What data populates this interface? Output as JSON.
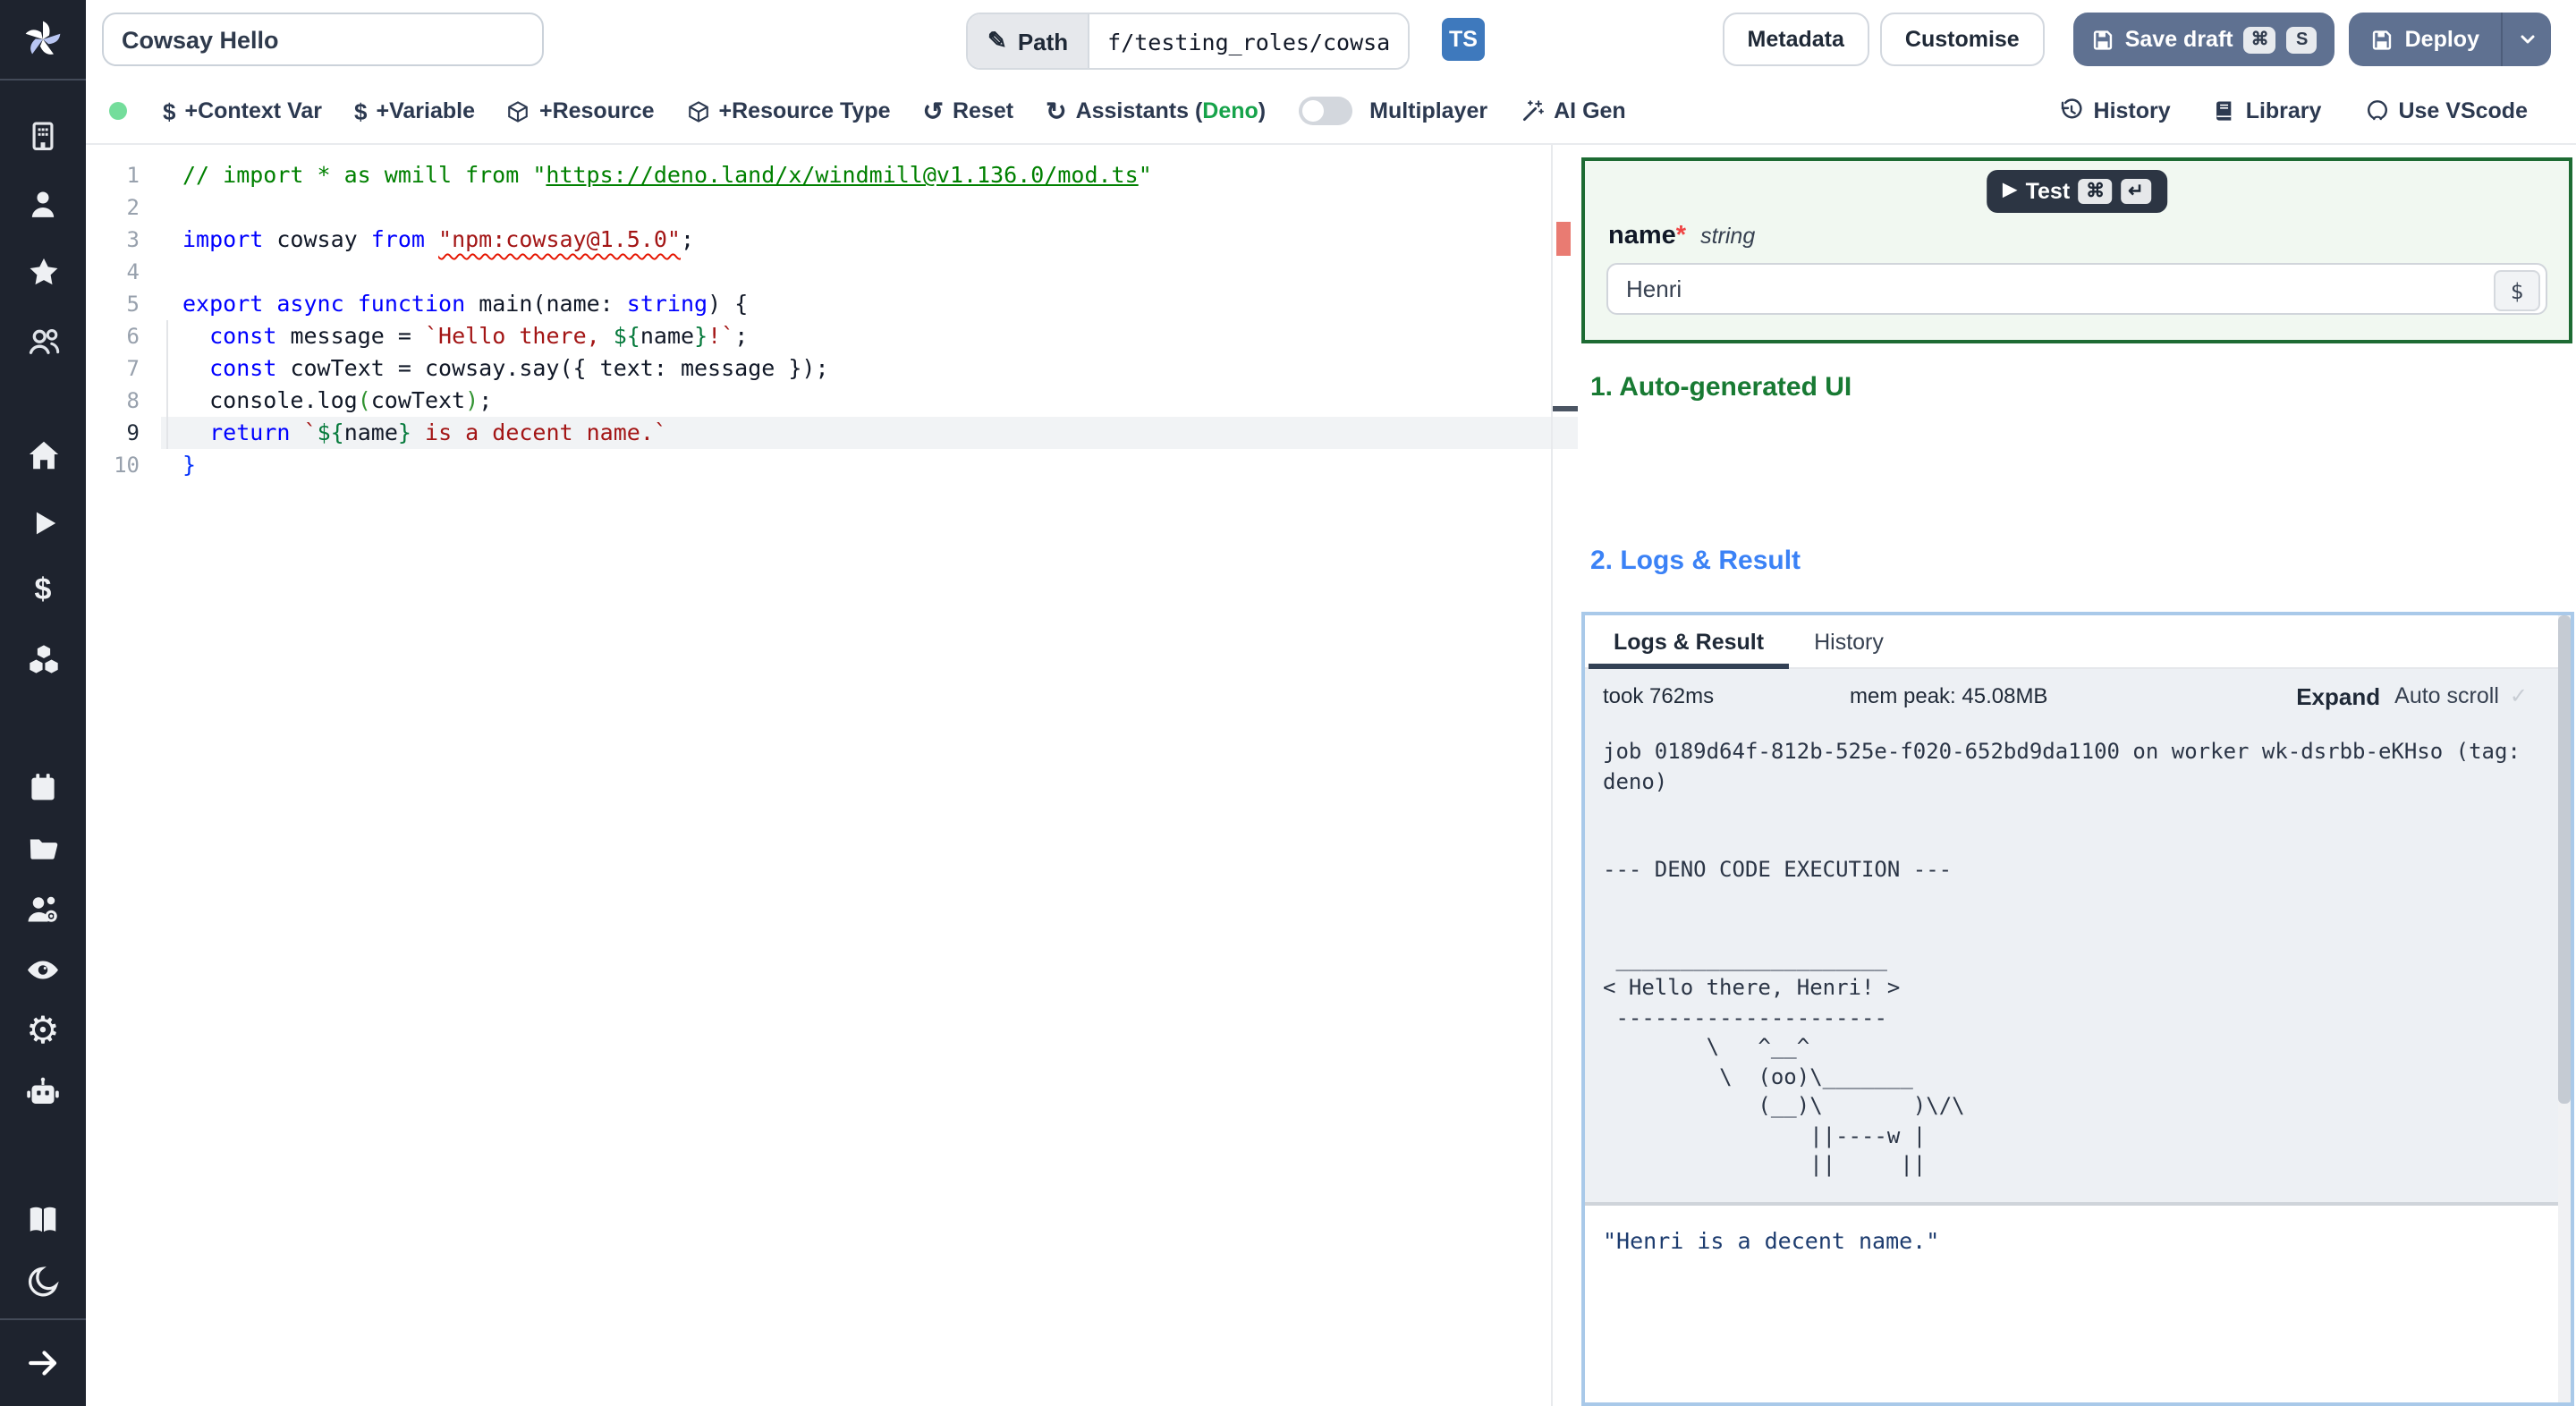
{
  "header": {
    "title": "Cowsay Hello",
    "path_label": "Path",
    "path_value": "f/testing_roles/cowsa",
    "lang_badge": "TS",
    "metadata": "Metadata",
    "customise": "Customise",
    "save_draft": "Save draft",
    "save_kbd": [
      "⌘",
      "S"
    ],
    "deploy": "Deploy"
  },
  "toolbar": {
    "context_var": "+Context Var",
    "variable": "+Variable",
    "resource": "+Resource",
    "resource_type": "+Resource Type",
    "reset": "Reset",
    "assistants_prefix": "Assistants (",
    "assistants_lang": "Deno",
    "assistants_suffix": ")",
    "multiplayer": "Multiplayer",
    "ai_gen": "AI Gen",
    "history": "History",
    "library": "Library",
    "vscode": "Use VScode"
  },
  "editor": {
    "lines": [
      {
        "n": "1",
        "tokens": [
          [
            "cm",
            "// import * as wmill from \""
          ],
          [
            "cmu",
            "https://deno.land/x/windmill@v1.136.0/mod.ts"
          ],
          [
            "cm",
            "\""
          ]
        ]
      },
      {
        "n": "2",
        "tokens": []
      },
      {
        "n": "3",
        "tokens": [
          [
            "kw",
            "import"
          ],
          [
            "tx",
            " cowsay "
          ],
          [
            "kw",
            "from"
          ],
          [
            "tx",
            " "
          ],
          [
            "sq",
            "\"npm:cowsay@1.5.0\""
          ],
          [
            "tx",
            ";"
          ]
        ]
      },
      {
        "n": "4",
        "tokens": []
      },
      {
        "n": "5",
        "tokens": [
          [
            "kw",
            "export"
          ],
          [
            "tx",
            " "
          ],
          [
            "kw",
            "async"
          ],
          [
            "tx",
            " "
          ],
          [
            "kw",
            "function"
          ],
          [
            "tx",
            " main(name: "
          ],
          [
            "kw",
            "string"
          ],
          [
            "tx",
            ") {"
          ]
        ]
      },
      {
        "n": "6",
        "tokens": [
          [
            "tx",
            "  "
          ],
          [
            "kw",
            "const"
          ],
          [
            "tx",
            " message = "
          ],
          [
            "st",
            "`Hello there, "
          ],
          [
            "ex",
            "${"
          ],
          [
            "tx",
            "name"
          ],
          [
            "ex",
            "}"
          ],
          [
            "st",
            "!`"
          ],
          [
            "tx",
            ";"
          ]
        ]
      },
      {
        "n": "7",
        "tokens": [
          [
            "tx",
            "  "
          ],
          [
            "kw",
            "const"
          ],
          [
            "tx",
            " cowText = cowsay.say({ text: message });"
          ]
        ]
      },
      {
        "n": "8",
        "tokens": [
          [
            "tx",
            "  console.log"
          ],
          [
            "gr",
            "("
          ],
          [
            "tx",
            "cowText"
          ],
          [
            "gr",
            ")"
          ],
          [
            "tx",
            ";"
          ]
        ]
      },
      {
        "n": "9",
        "active": true,
        "tokens": [
          [
            "tx",
            "  "
          ],
          [
            "kw",
            "return"
          ],
          [
            "tx",
            " "
          ],
          [
            "st",
            "`"
          ],
          [
            "ex",
            "${"
          ],
          [
            "tx",
            "name"
          ],
          [
            "ex",
            "}"
          ],
          [
            "st",
            " is a decent name.`"
          ]
        ]
      },
      {
        "n": "10",
        "tokens": [
          [
            "bl",
            "}"
          ]
        ]
      }
    ]
  },
  "form": {
    "test": "Test",
    "test_kbd": [
      "⌘",
      "↵"
    ],
    "name_label": "name",
    "required_mark": "*",
    "type": "string",
    "value": "Henri",
    "dollar": "$"
  },
  "sections": {
    "auto_ui": "1. Auto-generated UI",
    "logs_result": "2. Logs & Result"
  },
  "logs": {
    "tabs": [
      "Logs & Result",
      "History"
    ],
    "took": "took 762ms",
    "mem": "mem peak: 45.08MB",
    "expand": "Expand",
    "autoscroll": "Auto scroll",
    "check": "✓",
    "log_text": "job 0189d64f-812b-525e-f020-652bd9da1100 on worker wk-dsrbb-eKHso (tag:\ndeno)\n\n\n--- DENO CODE EXECUTION ---\n\n\n _____________________\n< Hello there, Henri! >\n ---------------------\n        \\   ^__^\n         \\  (oo)\\_______\n            (__)\\       )\\/\\\n                ||----w |\n                ||     ||",
    "result": "\"Henri is a decent name.\""
  },
  "sidebar": {
    "icons": [
      "windmill-logo",
      "building",
      "user",
      "star",
      "users",
      "home",
      "play",
      "dollar",
      "boxes",
      "calendar",
      "folder-open",
      "user-gear",
      "eye",
      "gear",
      "robot",
      "book-open",
      "moon",
      "arrow-right"
    ]
  },
  "glyphs": {
    "pencil": "✎",
    "reset_arrow": "↺",
    "refresh_arrow": "↻",
    "play": "▶"
  },
  "colors": {
    "primary_slate": "#5f7191",
    "ts_blue": "#3e79bd",
    "deno_green": "#16a34a",
    "heading_green": "#187a33",
    "heading_blue": "#3b82f6",
    "focus_ring": "#a9c9e9",
    "error_marker_red": "#e97b72",
    "status_green": "#74dd9b",
    "sidebar_bg": "#1e232e"
  }
}
